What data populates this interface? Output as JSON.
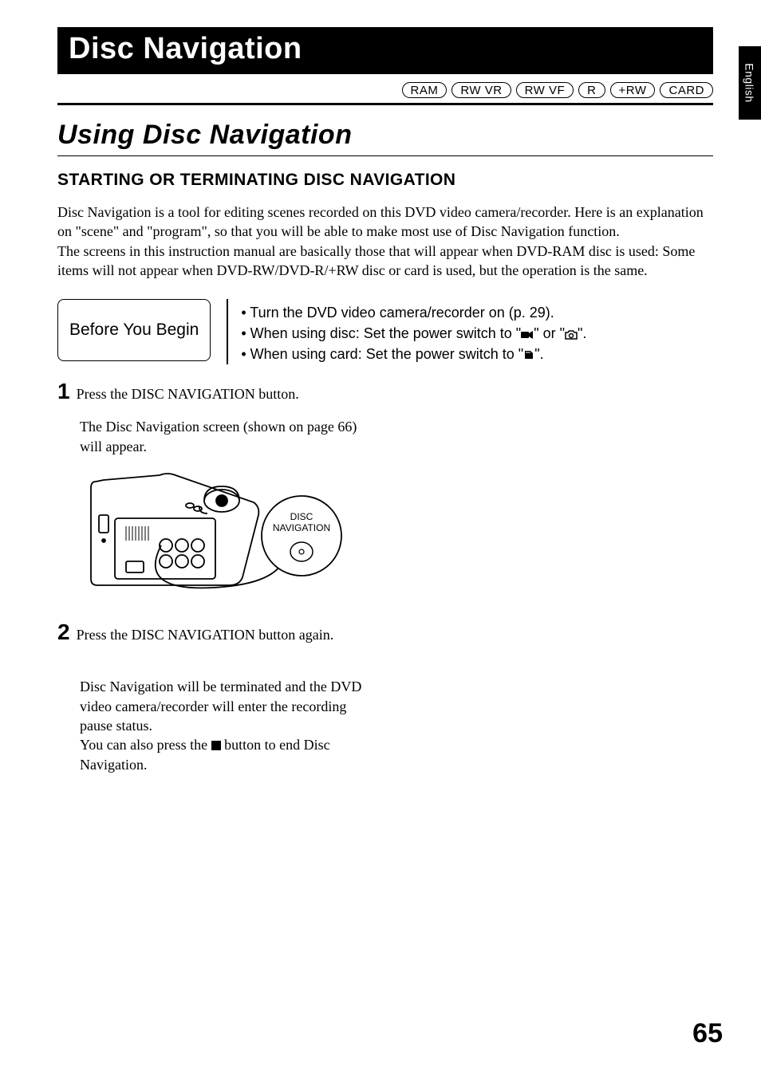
{
  "side_tab": "English",
  "chapter_title": "Disc Navigation",
  "tags": [
    "RAM",
    "RW VR",
    "RW VF",
    "R",
    "+RW",
    "CARD"
  ],
  "section_title": "Using Disc Navigation",
  "subhead": "STARTING OR TERMINATING DISC NAVIGATION",
  "intro": "Disc Navigation is a tool for editing scenes recorded on this DVD video camera/recorder. Here is an explanation on \"scene\" and \"program\", so that you will be able to make most use of Disc Navigation function.\nThe screens in this instruction manual are basically those that will appear when DVD-RAM disc is used: Some items will not appear when DVD-RW/DVD-R/+RW disc or card is used, but the operation is the same.",
  "byb": {
    "label": "Before You Begin",
    "items": {
      "i0": "Turn the DVD video camera/recorder on (p. 29).",
      "i1_pre": "When using disc: Set the power switch to \"",
      "i1_mid": "\" or \"",
      "i1_post": "\".",
      "i2_pre": "When using card: Set the power switch to \"",
      "i2_post": "\"."
    }
  },
  "steps": {
    "s1": {
      "num": "1",
      "text": "Press the DISC NAVIGATION button.",
      "body": "The Disc Navigation screen (shown on page 66) will appear.",
      "disc_label_1": "DISC",
      "disc_label_2": "NAVIGATION"
    },
    "s2": {
      "num": "2",
      "text": "Press the DISC NAVIGATION button again.",
      "body_pre": "Disc Navigation will be terminated and the DVD video camera/recorder will enter the recording pause status.\nYou can also press the ",
      "body_post": " button to end Disc Navigation."
    }
  },
  "page_number": "65"
}
